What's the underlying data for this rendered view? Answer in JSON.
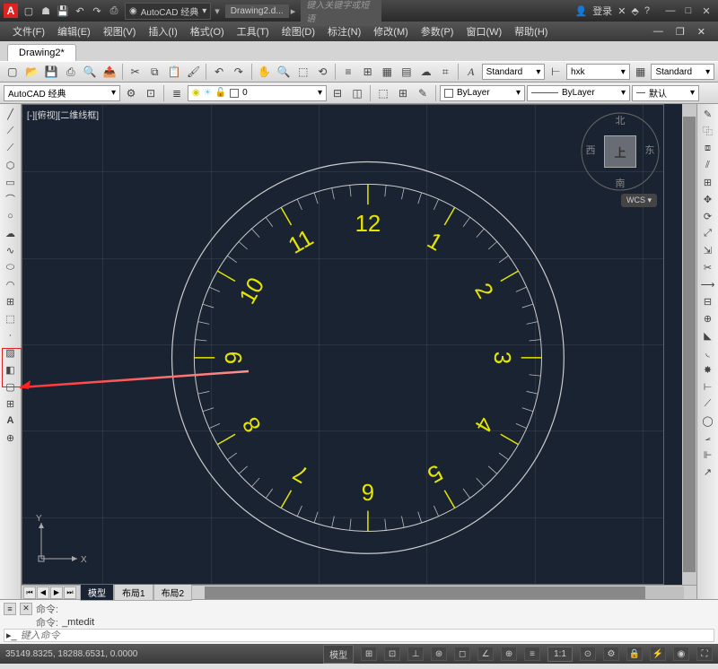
{
  "titlebar": {
    "workspace": "AutoCAD 经典",
    "doc": "Drawing2.d...",
    "search_ph": "键入关键字或短语",
    "login": "登录"
  },
  "menu": [
    "文件(F)",
    "编辑(E)",
    "视图(V)",
    "插入(I)",
    "格式(O)",
    "工具(T)",
    "绘图(D)",
    "标注(N)",
    "修改(M)",
    "参数(P)",
    "窗口(W)",
    "帮助(H)"
  ],
  "filetab": "Drawing2*",
  "tb1_text_style": "Standard",
  "tb1_dim_style": "hxk",
  "tb1_table_style": "Standard",
  "tb2": {
    "workspace": "AutoCAD 经典",
    "layer_color": "ByLayer",
    "linetype": "ByLayer",
    "lineweight": "默认"
  },
  "viewport_label": "[-][俯视][二维线框]",
  "viewcube": {
    "n": "北",
    "s": "南",
    "e": "东",
    "w": "西",
    "face": "上"
  },
  "wcs": "WCS",
  "ucs": {
    "x": "X",
    "y": "Y"
  },
  "layout_tabs": [
    "模型",
    "布局1",
    "布局2"
  ],
  "cmd": {
    "line1": "命令:",
    "line2_label": "命令:",
    "line2_val": "_mtedit",
    "input_ph": "键入命令"
  },
  "status": {
    "coords": "35149.8325, 18288.6531, 0.0000",
    "model": "模型",
    "scale": "1:1"
  },
  "clock": {
    "numbers": [
      "12",
      "1",
      "2",
      "3",
      "4",
      "5",
      "6",
      "7",
      "8",
      "9",
      "10",
      "11"
    ]
  },
  "chart_data": {
    "type": "diagram",
    "description": "AutoCAD drawing of analog clock face",
    "outer_circle": true,
    "inner_circle": true,
    "hour_marks": 12,
    "minute_marks": 60,
    "numerals": [
      12,
      1,
      2,
      3,
      4,
      5,
      6,
      7,
      8,
      9,
      10,
      11
    ],
    "center": [
      400,
      400
    ]
  }
}
